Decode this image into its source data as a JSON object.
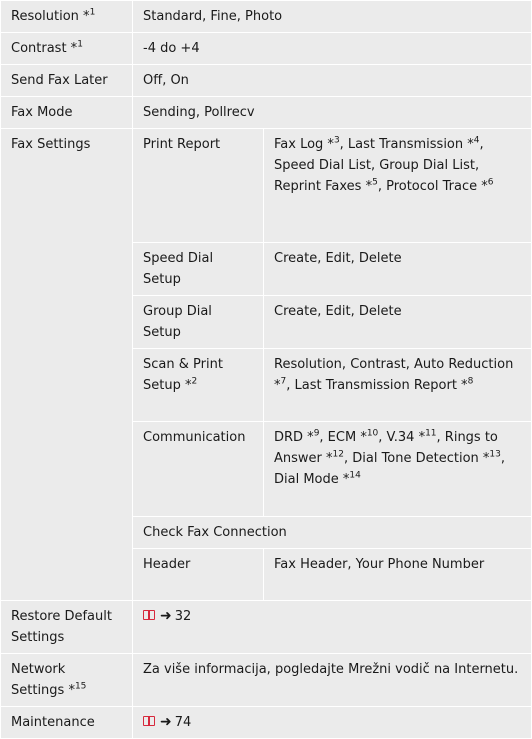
{
  "rows": {
    "resolution": {
      "label": "Resolution *",
      "label_sup": "1",
      "value": "Standard, Fine, Photo"
    },
    "contrast": {
      "label": "Contrast *",
      "label_sup": "1",
      "value": "-4 do +4"
    },
    "send_fax_later": {
      "label": "Send Fax Later",
      "value": "Off, On"
    },
    "fax_mode": {
      "label": "Fax Mode",
      "value": "Sending, Pollrecv"
    },
    "fax_settings": {
      "label": "Fax Settings",
      "print_report": {
        "label": "Print Report",
        "v1": "Fax Log *",
        "s1": "3",
        "v2": ", Last Transmission *",
        "s2": "4",
        "v3": ", Speed Dial List, Group Dial List, Reprint Faxes *",
        "s3": "5",
        "v4": ", Protocol Trace *",
        "s4": "6"
      },
      "speed_dial_setup": {
        "label": "Speed Dial Setup",
        "value": "Create, Edit, Delete"
      },
      "group_dial_setup": {
        "label": "Group Dial Setup",
        "value": "Create, Edit, Delete"
      },
      "scan_print_setup": {
        "label": "Scan & Print Setup *",
        "label_sup": "2",
        "v1": "Resolution, Contrast, Auto Reduction *",
        "s1": "7",
        "v2": ", Last Transmission Report *",
        "s2": "8"
      },
      "communication": {
        "label": "Communication",
        "v1": "DRD *",
        "s1": "9",
        "v2": ", ECM *",
        "s2": "10",
        "v3": ", V.34 *",
        "s3": "11",
        "v4": ", Rings to Answer *",
        "s4": "12",
        "v5": ", Dial Tone Detection *",
        "s5": "13",
        "v6": ", Dial Mode *",
        "s6": "14"
      },
      "check_fax_connection": {
        "label": "Check Fax Connection"
      },
      "header": {
        "label": "Header",
        "value": "Fax Header, Your Phone Number"
      }
    },
    "restore_default": {
      "label": "Restore Default Settings",
      "page": "32"
    },
    "network_settings": {
      "label": "Network Settings *",
      "label_sup": "15",
      "value": "Za više informacija, pogledajte Mrežni vodič na Internetu."
    },
    "maintenance": {
      "label": "Maintenance",
      "page": "74"
    }
  }
}
